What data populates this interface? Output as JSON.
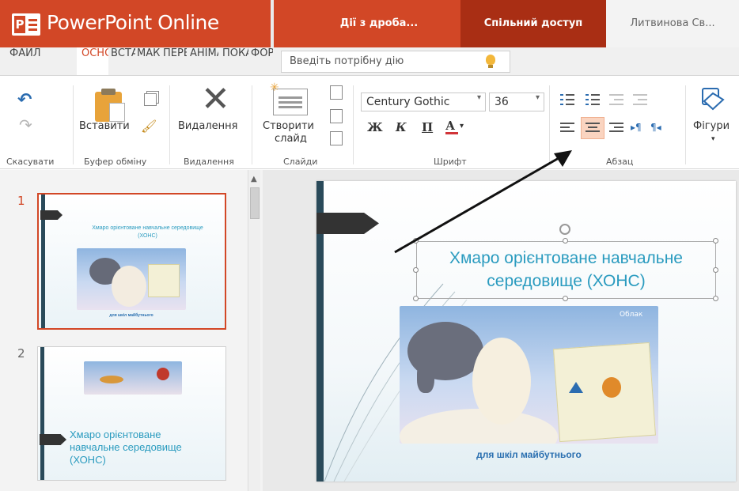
{
  "titlebar": {
    "app_name": "PowerPoint Online",
    "document_title": "Дії з дроба...",
    "share_label": "Спільний доступ",
    "user_name": "Литвинова Св..."
  },
  "tabs": [
    {
      "label": "ФАЙЛ",
      "active": false
    },
    {
      "label": "ОСНОВНЕ",
      "active": true
    },
    {
      "label": "ВСТАВЛЕННЯ",
      "active": false
    },
    {
      "label": "МАКЕТ",
      "active": false
    },
    {
      "label": "ПЕРЕХОДИ",
      "active": false
    },
    {
      "label": "АНІМАЦІЯ",
      "active": false
    },
    {
      "label": "ПОКАЗ",
      "active": false
    },
    {
      "label": "ФОРМАТ",
      "active": false
    }
  ],
  "tell_me": {
    "placeholder": "Введіть потрібну дію"
  },
  "ribbon": {
    "undo_group": {
      "label": "Скасувати"
    },
    "clipboard": {
      "paste_label": "Вставити",
      "group_label": "Буфер обміну"
    },
    "delete": {
      "button_label": "Видалення",
      "group_label": "Видалення"
    },
    "slides": {
      "new_slide_label_line1": "Створити",
      "new_slide_label_line2": "слайд",
      "group_label": "Слайди"
    },
    "font": {
      "family": "Century Gothic",
      "size": "36",
      "bold": "Ж",
      "italic": "К",
      "underline": "П",
      "color": "А",
      "group_label": "Шрифт"
    },
    "paragraph": {
      "group_label": "Абзац",
      "active_alignment": "center"
    },
    "shapes": {
      "label": "Фігури"
    }
  },
  "thumbnails": [
    {
      "number": "1",
      "title": "Хмаро орієнтоване навчальне середовище (ХОНС)",
      "subtitle": "для шкіл майбутнього",
      "selected": true
    },
    {
      "number": "2",
      "title": "Хмаро орієнтоване навчальне середовище (ХОНС)",
      "selected": false
    }
  ],
  "slide": {
    "title": "Хмаро орієнтоване навчальне середовище (ХОНС)",
    "subtitle": "для шкіл майбутнього",
    "cloud_logo": "Облак"
  },
  "colors": {
    "accent": "#d24726",
    "share": "#a92e14",
    "title_text": "#2a9bbf",
    "slide_bar": "#2a4a5a",
    "selection": "#fad4c0"
  }
}
